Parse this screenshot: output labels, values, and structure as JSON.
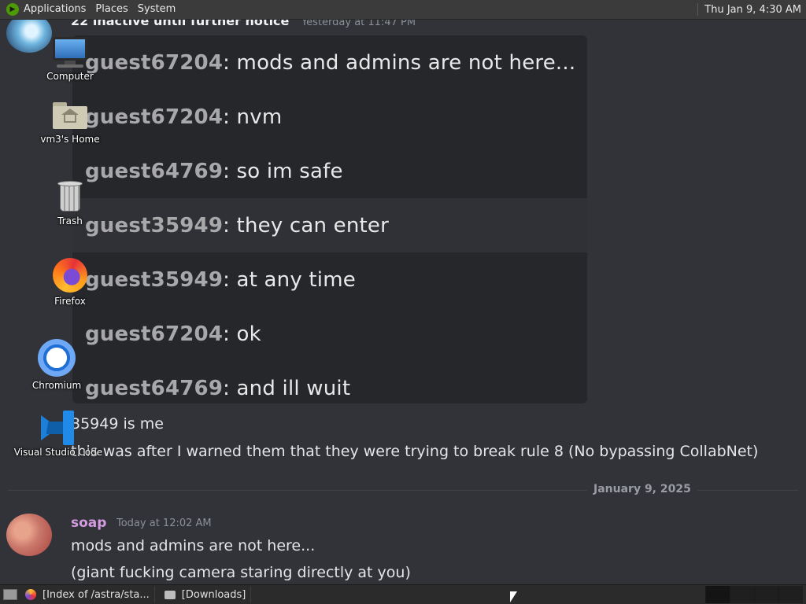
{
  "top_panel": {
    "menus": [
      "Applications",
      "Places",
      "System"
    ],
    "clock": "Thu Jan  9,  4:30 AM"
  },
  "chat": {
    "previous_message": {
      "text": "22 inactive until further notice",
      "timestamp": "Yesterday at 11:47 PM"
    },
    "embed_rows": [
      {
        "user": "guest67204",
        "text": ": mods and admins are not here..."
      },
      {
        "user": "guest67204",
        "text": ": nvm"
      },
      {
        "user": "guest64769",
        "text": ": so im safe"
      },
      {
        "user": "guest35949",
        "text": ": they can enter"
      },
      {
        "user": "guest35949",
        "text": ": at any time"
      },
      {
        "user": "guest67204",
        "text": ": ok"
      },
      {
        "user": "guest64769",
        "text": ": and ill wuit"
      }
    ],
    "line_1": "35949 is me",
    "line_2": "this was after I warned them that they were trying to break rule 8 (No bypassing CollabNet)",
    "date_divider": "January 9, 2025",
    "soap_message": {
      "author": "soap",
      "timestamp": "Today at 12:02 AM",
      "line_1": "mods and admins are not here...",
      "line_2": "(giant fucking camera staring directly at you)"
    }
  },
  "desktop_icons": [
    {
      "label": "Computer",
      "icon": "computer-icon"
    },
    {
      "label": "vm3's Home",
      "icon": "home-folder-icon"
    },
    {
      "label": "Trash",
      "icon": "trash-icon"
    },
    {
      "label": "Firefox",
      "icon": "firefox-icon"
    },
    {
      "label": "Chromium",
      "icon": "chromium-icon"
    },
    {
      "label": "Visual Studio Code",
      "icon": "vscode-icon"
    }
  ],
  "taskbar": {
    "tasks": [
      {
        "label": "[Index of /astra/sta...",
        "icon": "firefox-icon"
      },
      {
        "label": "[Downloads]",
        "icon": "folder-icon"
      }
    ]
  },
  "colors": {
    "background": "#313338",
    "embed_background": "#25272b",
    "panel": "#3b3b3b",
    "soap_name": "#d59be0"
  }
}
